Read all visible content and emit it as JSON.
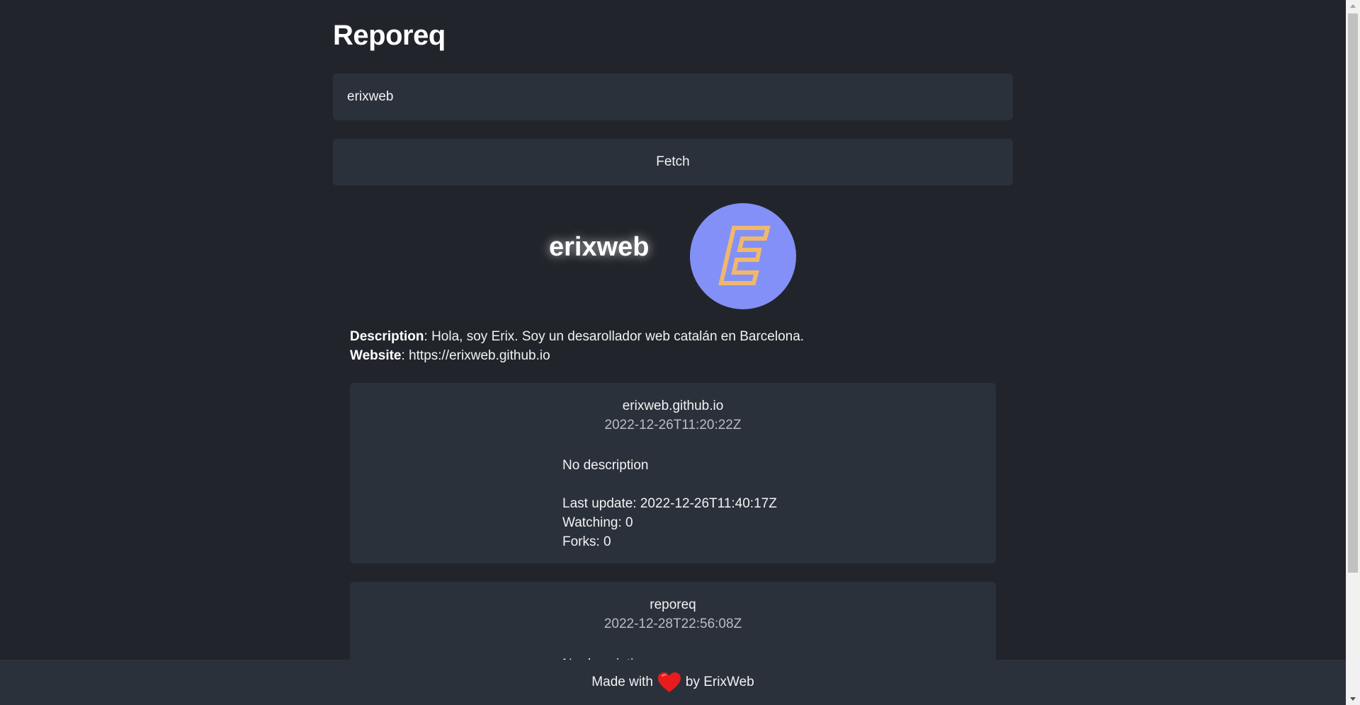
{
  "app": {
    "title": "Reporeq"
  },
  "search": {
    "value": "erixweb"
  },
  "fetch_button": {
    "label": "Fetch"
  },
  "profile": {
    "name": "erixweb",
    "description_label": "Description",
    "description": ": Hola, soy Erix. Soy un desarollador web catalán en Barcelona.",
    "website_label": "Website",
    "website": ": https://erixweb.github.io",
    "avatar_color": "#8390f7",
    "avatar_letter_color": "#f0b86a"
  },
  "repos": [
    {
      "name": "erixweb.github.io",
      "created": "2022-12-26T11:20:22Z",
      "description": "No description",
      "last_update": "Last update: 2022-12-26T11:40:17Z",
      "watching": "Watching: 0",
      "forks": "Forks: 0"
    },
    {
      "name": "reporeq",
      "created": "2022-12-28T22:56:08Z",
      "description": "No description"
    }
  ],
  "footer": {
    "made_with": "Made with",
    "by": "by ErixWeb",
    "heart_icon": "heart-icon",
    "heart_color": "#e81c1c"
  },
  "colors": {
    "background": "#21252b",
    "surface": "#2b313b",
    "text": "#f2f2f2"
  }
}
